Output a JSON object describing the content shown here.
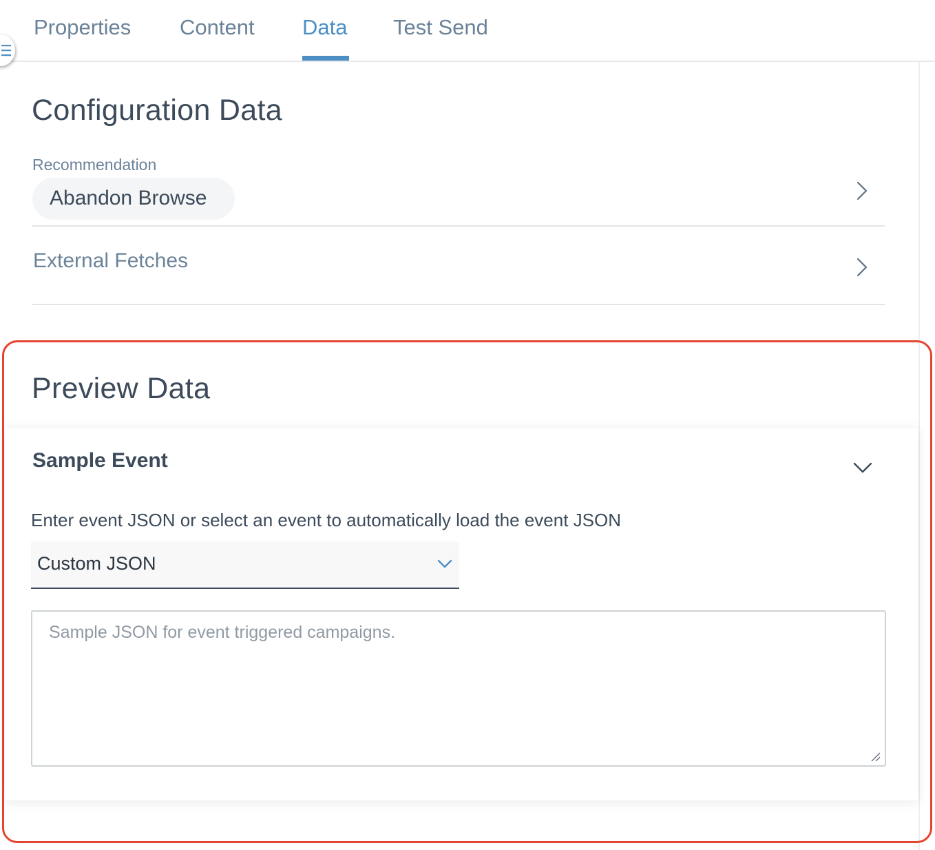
{
  "tabs": [
    {
      "label": "Properties",
      "active": false
    },
    {
      "label": "Content",
      "active": false
    },
    {
      "label": "Data",
      "active": true
    },
    {
      "label": "Test Send",
      "active": false
    }
  ],
  "configuration": {
    "title": "Configuration Data",
    "recommendation_label": "Recommendation",
    "recommendation_value": "Abandon Browse",
    "external_fetches_label": "External Fetches"
  },
  "preview": {
    "title": "Preview Data",
    "sample_event": {
      "title": "Sample Event",
      "description": "Enter event JSON or select an event to automatically load the event JSON",
      "select_value": "Custom JSON",
      "json_value": "",
      "json_placeholder": "Sample JSON for event triggered campaigns."
    }
  },
  "icons": {
    "menu": "hamburger-icon",
    "recommendation_chevron": "chevron-right-icon",
    "external_fetches_chevron": "chevron-right-icon",
    "sample_event_toggle": "chevron-down-icon",
    "select_arrow": "chevron-down-icon",
    "resize": "resize-grip-icon"
  },
  "colors": {
    "accent": "#4d8fc4",
    "text_primary": "#3c4a5a",
    "text_muted": "#6b8399",
    "highlight": "#e5452f"
  }
}
